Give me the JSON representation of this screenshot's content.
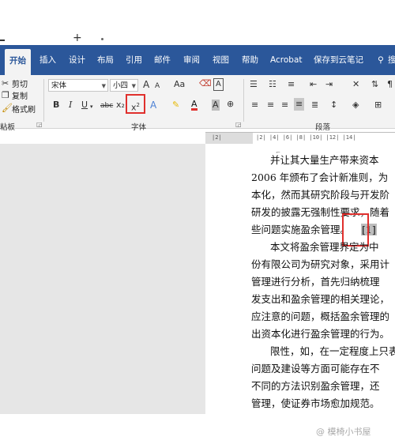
{
  "window": {
    "new_tab_symbol": "+"
  },
  "tabs": [
    {
      "label": "开始"
    },
    {
      "label": "插入"
    },
    {
      "label": "设计"
    },
    {
      "label": "布局"
    },
    {
      "label": "引用"
    },
    {
      "label": "邮件"
    },
    {
      "label": "审阅"
    },
    {
      "label": "视图"
    },
    {
      "label": "帮助"
    },
    {
      "label": "Acrobat"
    },
    {
      "label": "保存到云笔记"
    },
    {
      "label": "搜"
    }
  ],
  "clipboard": {
    "cut": "剪切",
    "copy": "复制",
    "format_painter": "格式刷",
    "group": "粘板"
  },
  "font": {
    "name": "宋体",
    "size": "小四",
    "grow": "A",
    "shrink": "A",
    "case": "Aa",
    "bold": "B",
    "italic": "I",
    "underline": "U",
    "strike": "abc",
    "subscript": "x₂",
    "superscript": "x",
    "superscript_mark": "2",
    "text_effects": "A",
    "highlight": "✎",
    "font_color": "A",
    "shading": "A",
    "circle": "⊕",
    "group": "字体"
  },
  "paragraph": {
    "group": "段落"
  },
  "ruler": {
    "left": "|2|",
    "marks": "|2|  |4|  |6|  |8|  |10| |12| |14|"
  },
  "document": {
    "lines": [
      "并让其大量生产带来资本",
      "2006 年颁布了会计新准则，为",
      "本化，然而其研究阶段与开发阶",
      "研发的披露无强制性要求，随着",
      "些问题实施盈余管理。",
      "本文将盈余管理界定为中",
      "份有限公司为研究对象，采用计",
      "管理进行分析，首先归纳梳理",
      "发支出和盈余管理的相关理论，",
      "应注意的问题，概括盈余管理的",
      "出资本化进行盈余管理的行为。",
      "限性，如，在一定程度上只表明",
      "问题及建设等方面可能存在不",
      "不同的方法识别盈余管理，还",
      "管理，使证券市场愈加规范。"
    ],
    "citation": "[1]",
    "under_word": "管理"
  },
  "watermark": "@ 模椅小书屋"
}
